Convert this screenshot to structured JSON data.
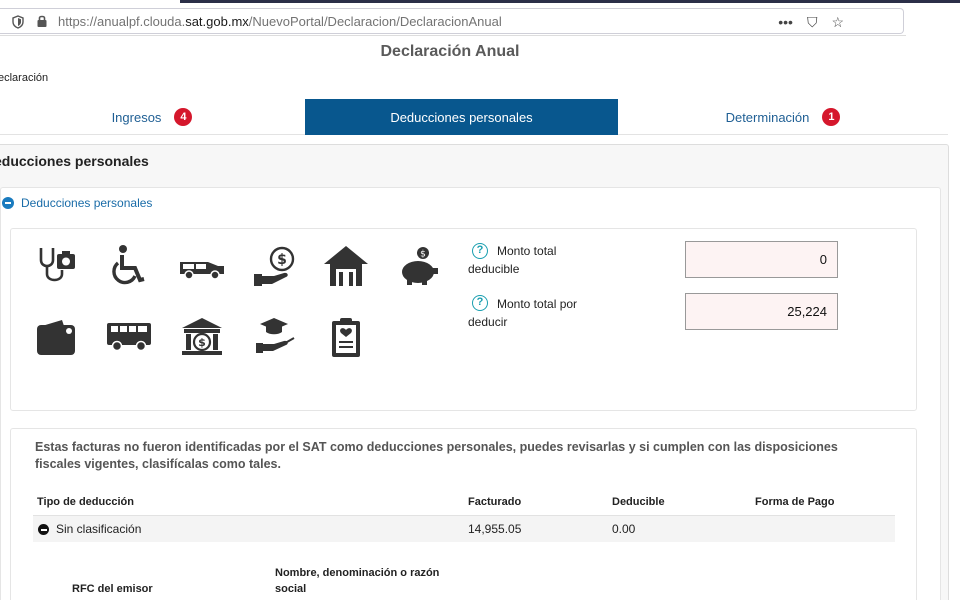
{
  "browser": {
    "url_prefix": "https://anualpf.clouda.",
    "url_domain": "sat.gob.mx",
    "url_path": "/NuevoPortal/Declaracion/DeclaracionAnual",
    "more_glyph": "•••",
    "pocket_glyph": "⛉",
    "star_glyph": "☆"
  },
  "header": {
    "title": "Declaración Anual",
    "breadcrumb": "eclaración"
  },
  "tabs": [
    {
      "label": "Ingresos",
      "badge": "4"
    },
    {
      "label": "Deducciones personales",
      "badge": ""
    },
    {
      "label": "Determinación",
      "badge": "1"
    }
  ],
  "panel": {
    "title": "educciones personales",
    "section_label": "Deducciones personales"
  },
  "icons": [
    "medical-stethoscope-icon",
    "wheelchair-icon",
    "hearse-icon",
    "money-hand-icon",
    "house-icon",
    "piggy-bank-icon",
    "wallet-icon",
    "school-bus-icon",
    "bank-icon",
    "graduation-hand-icon",
    "clipboard-icon"
  ],
  "montos": {
    "total_deducible_label_1": "Monto total",
    "total_deducible_label_2": "deducible",
    "total_deducible_value": "0",
    "total_por_deducir_label_1": "Monto total por",
    "total_por_deducir_label_2": "deducir",
    "total_por_deducir_value": "25,224",
    "help_glyph": "?"
  },
  "facturas": {
    "notice_line1": "Estas facturas no fueron identificadas por el SAT como deducciones personales, puedes revisarlas y si cumplen con las disposiciones",
    "notice_line2": "fiscales vigentes, clasifícalas como tales.",
    "columns": [
      "Tipo de deducción",
      "Facturado",
      "Deducible",
      "Forma de Pago"
    ],
    "rows": [
      {
        "tipo": "Sin clasificación",
        "facturado": "14,955.05",
        "deducible": "0.00",
        "forma_pago": ""
      }
    ],
    "sub_columns": {
      "rfc": "RFC del emisor",
      "nombre_1": "Nombre, denominación o razón",
      "nombre_2": "social"
    }
  },
  "colors": {
    "accent": "#08578e",
    "badge": "#d5172c",
    "link": "#1f5f94"
  }
}
